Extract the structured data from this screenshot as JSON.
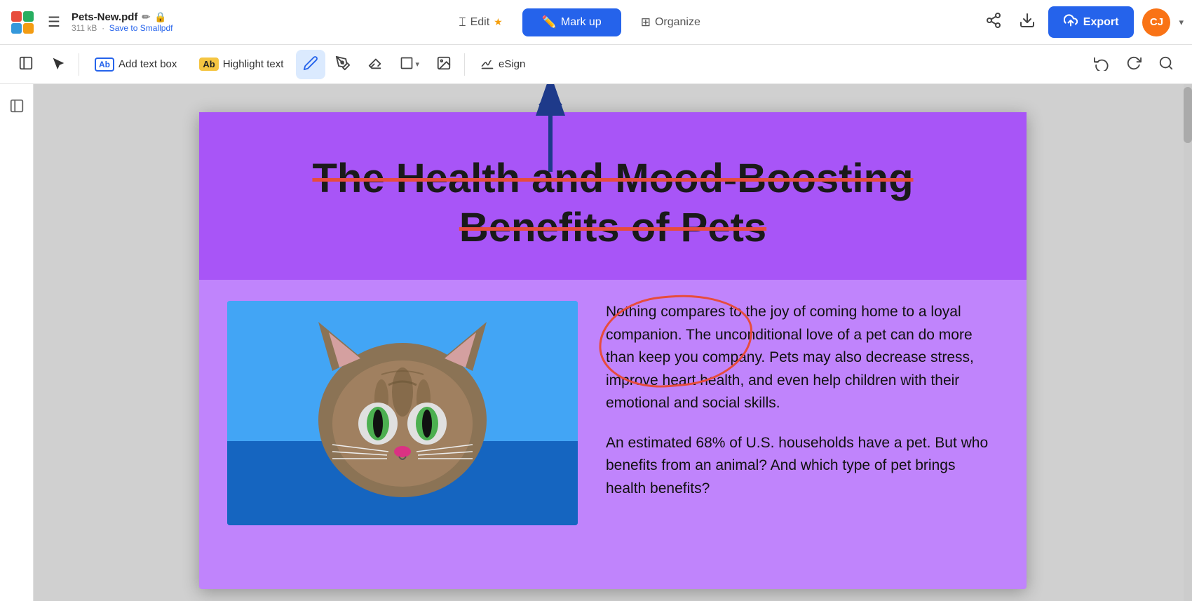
{
  "app": {
    "logo_quarters": [
      "#e74c3c",
      "#27ae60",
      "#3498db",
      "#f39c12"
    ]
  },
  "top_bar": {
    "hamburger_label": "☰",
    "file_name": "Pets-New.pdf",
    "file_pencil": "✏",
    "file_lock": "🔒",
    "file_size": "311 kB",
    "file_save_link": "Save to Smallpdf",
    "nav_tabs": [
      {
        "id": "edit",
        "label": "Edit",
        "icon": "⌶",
        "star": "★",
        "active": false
      },
      {
        "id": "markup",
        "label": "Mark up",
        "icon": "✏",
        "active": true
      },
      {
        "id": "organize",
        "label": "Organize",
        "icon": "⊞",
        "active": false
      }
    ],
    "share_icon": "⇧",
    "download_icon": "⬇",
    "export_label": "Export",
    "export_icon": "⬆",
    "avatar_initials": "CJ",
    "avatar_chevron": "▾"
  },
  "toolbar": {
    "cursor_icon": "↖",
    "add_text_box_label": "Add text box",
    "highlight_text_label": "Highlight text",
    "pencil_icon": "✏",
    "pen_icon": "✒",
    "eraser_icon": "⌫",
    "shape_icon": "□",
    "shape_chevron": "▾",
    "image_icon": "🖼",
    "esign_label": "eSign",
    "esign_icon": "✍",
    "undo_icon": "↩",
    "redo_icon": "↪",
    "search_icon": "🔍"
  },
  "pdf": {
    "title_line1": "The Health and Mood-Boosting",
    "title_line2": "Benefits of Pets",
    "paragraph1": "Nothing compares to the joy of coming home to a loyal companion. The unconditional love of a pet can do more than keep you company. Pets may also decrease stress, improve heart health,  and  even  help children  with  their emotional and social skills.",
    "paragraph2": "An estimated 68% of U.S. households have a pet. But who benefits from an animal? And which type of pet brings health benefits?"
  }
}
